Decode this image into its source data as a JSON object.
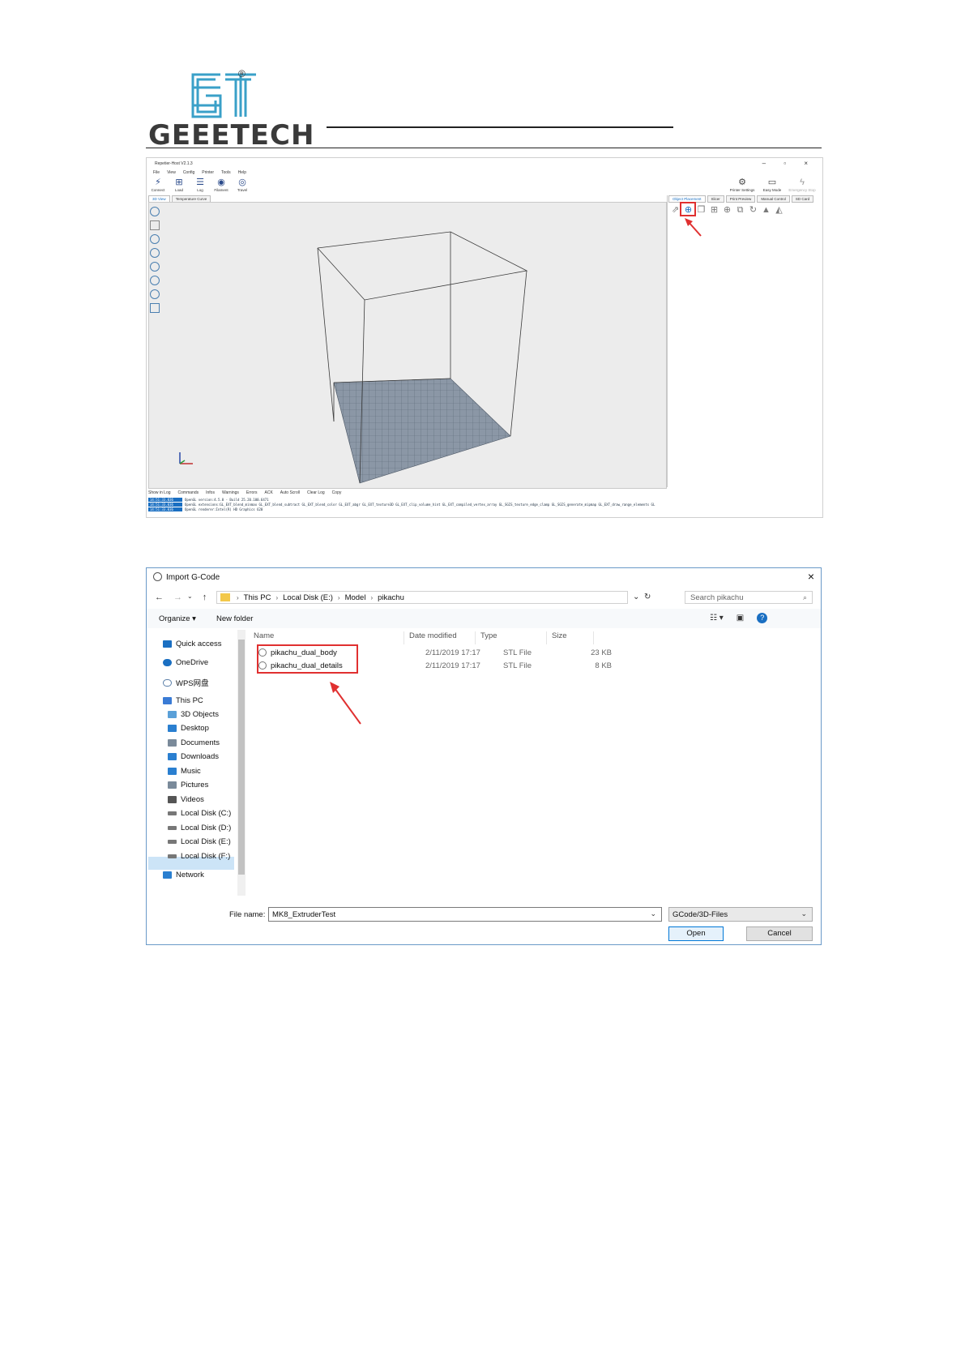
{
  "header": {
    "brand": "GEEETECH",
    "logo_mark": "GT",
    "registered": "®",
    "brand_color": "#3aa0c8"
  },
  "repetier": {
    "title": "Repetier-Host V2.1.3",
    "window_controls": "–  ▫  ×",
    "menu": [
      "File",
      "View",
      "Config",
      "Printer",
      "Tools",
      "Help"
    ],
    "toolbar": [
      {
        "label": "Connect",
        "icon": "plug-icon"
      },
      {
        "label": "Load",
        "icon": "load-icon"
      },
      {
        "label": "Log",
        "icon": "log-icon"
      },
      {
        "label": "Filament",
        "icon": "eye-icon"
      },
      {
        "label": "Travel",
        "icon": "eye-icon"
      }
    ],
    "right_toolbar": [
      {
        "label": "Printer Settings",
        "icon": "gear-icon"
      },
      {
        "label": "Easy Mode",
        "icon": "easy-mode-icon"
      },
      {
        "label": "Emergency Stop",
        "icon": "lightning-icon"
      }
    ],
    "view_tabs": [
      "3D View",
      "Temperature Curve"
    ],
    "panel_tabs": [
      "Object Placement",
      "Slicer",
      "Print Preview",
      "Manual Control",
      "SD Card"
    ],
    "log_filters": [
      "Show in Log",
      "Commands",
      "Infos",
      "Warnings",
      "Errors",
      "ACK",
      "Auto Scroll",
      "Clear Log",
      "Copy"
    ],
    "log_lines": [
      {
        "time": "14:51:33.036",
        "text": "OpenGL version:4.5.0 - Build 25.20.100.6471"
      },
      {
        "time": "14:51:33.036",
        "text": "OpenGL extensions:GL_EXT_blend_minmax GL_EXT_blend_subtract GL_EXT_blend_color GL_EXT_abgr GL_EXT_texture3D GL_EXT_clip_volume_hint GL_EXT_compiled_vertex_array GL_SGIS_texture_edge_clamp GL_SGIS_generate_mipmap GL_EXT_draw_range_elements GL"
      },
      {
        "time": "14:51:33.036",
        "text": "OpenGL renderer:Intel(R) HD Graphics 620"
      }
    ]
  },
  "dialog": {
    "title": "Import G-Code",
    "close": "×",
    "breadcrumbs": [
      "This PC",
      "Local Disk (E:)",
      "Model",
      "pikachu"
    ],
    "search_placeholder": "Search pikachu",
    "organize": "Organize ▾",
    "new_folder": "New folder",
    "nav_items": [
      {
        "label": "Quick access",
        "icon": "star-icon",
        "color": "#1a6fc2"
      },
      {
        "label": "OneDrive",
        "icon": "cloud-icon",
        "color": "#1a6fc2"
      },
      {
        "label": "WPS网盘",
        "icon": "cloud-outline-icon",
        "color": "#5a7fa8"
      },
      {
        "label": "This PC",
        "icon": "monitor-icon",
        "color": "#3a7bd5"
      },
      {
        "label": "3D Objects",
        "icon": "cube-icon",
        "color": "#5aa0d8"
      },
      {
        "label": "Desktop",
        "icon": "desktop-icon",
        "color": "#2a7fd0"
      },
      {
        "label": "Documents",
        "icon": "document-icon",
        "color": "#7a8a9a"
      },
      {
        "label": "Downloads",
        "icon": "download-icon",
        "color": "#2a7fd0"
      },
      {
        "label": "Music",
        "icon": "music-icon",
        "color": "#2a7fd0"
      },
      {
        "label": "Pictures",
        "icon": "picture-icon",
        "color": "#7a8a9a"
      },
      {
        "label": "Videos",
        "icon": "video-icon",
        "color": "#555555"
      },
      {
        "label": "Local Disk (C:)",
        "icon": "disk-icon",
        "color": "#777777"
      },
      {
        "label": "Local Disk (D:)",
        "icon": "disk-icon",
        "color": "#777777"
      },
      {
        "label": "Local Disk (E:)",
        "icon": "disk-icon",
        "color": "#777777"
      },
      {
        "label": "Local Disk (F:)",
        "icon": "disk-icon",
        "color": "#777777"
      },
      {
        "label": "Network",
        "icon": "network-icon",
        "color": "#2a7fd0"
      }
    ],
    "selected_nav": "Local Disk (E:)",
    "columns": [
      "Name",
      "Date modified",
      "Type",
      "Size"
    ],
    "files": [
      {
        "name": "pikachu_dual_body",
        "date": "2/11/2019 17:17",
        "type": "STL File",
        "size": "23 KB"
      },
      {
        "name": "pikachu_dual_details",
        "date": "2/11/2019 17:17",
        "type": "STL File",
        "size": "8 KB"
      }
    ],
    "file_name_label": "File name:",
    "file_name_value": "MK8_ExtruderTest",
    "file_type_value": "GCode/3D-Files",
    "open_label": "Open",
    "cancel_label": "Cancel",
    "accent": "#e03030"
  }
}
